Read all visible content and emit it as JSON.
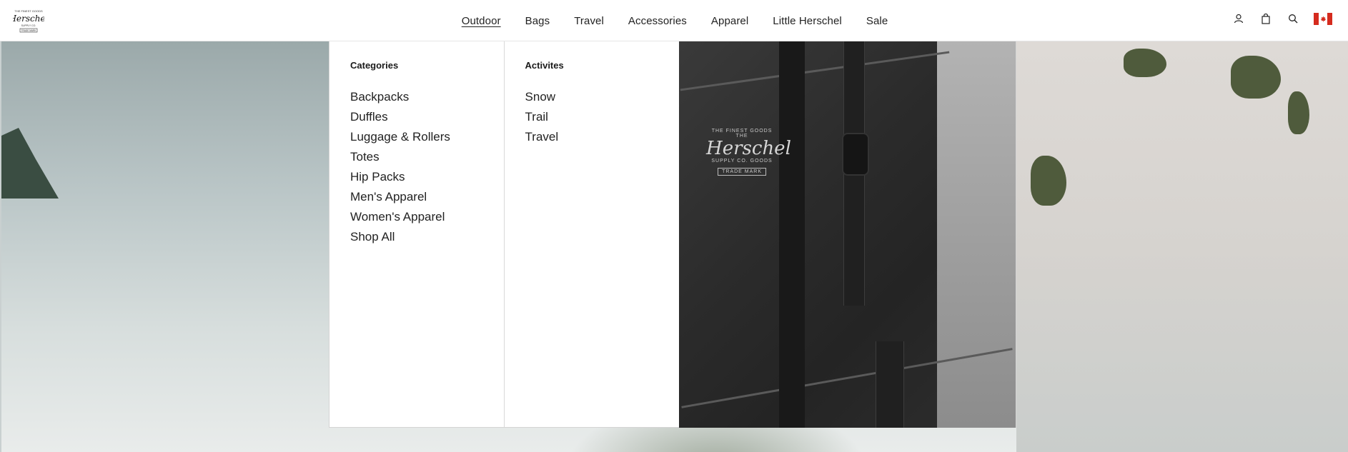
{
  "brand": {
    "logo_top": "THE FINEST GOODS",
    "logo_name": "Herschel",
    "logo_sub": "SUPPLY CO.",
    "logo_badge": "TRADE MARK"
  },
  "nav": {
    "items": [
      {
        "label": "Outdoor",
        "active": true
      },
      {
        "label": "Bags"
      },
      {
        "label": "Travel"
      },
      {
        "label": "Accessories"
      },
      {
        "label": "Apparel"
      },
      {
        "label": "Little Herschel"
      },
      {
        "label": "Sale"
      }
    ]
  },
  "utility": {
    "icons": [
      "account-icon",
      "bag-icon",
      "search-icon",
      "canada-flag-icon"
    ],
    "colors": {
      "flag_red": "#d52b1e"
    }
  },
  "mega_menu": {
    "categories": {
      "title": "Categories",
      "links": [
        "Backpacks",
        "Duffles",
        "Luggage & Rollers",
        "Totes",
        "Hip Packs",
        "Men's Apparel",
        "Women's Apparel",
        "Shop All"
      ]
    },
    "activities": {
      "title": "Activites",
      "links": [
        "Snow",
        "Trail",
        "Travel"
      ]
    },
    "promo": {
      "logo_top": "THE FINEST GOODS",
      "logo_the": "THE",
      "logo_name": "Herschel",
      "logo_sub": "SUPPLY CO. GOODS",
      "logo_badge": "TRADE MARK"
    }
  }
}
